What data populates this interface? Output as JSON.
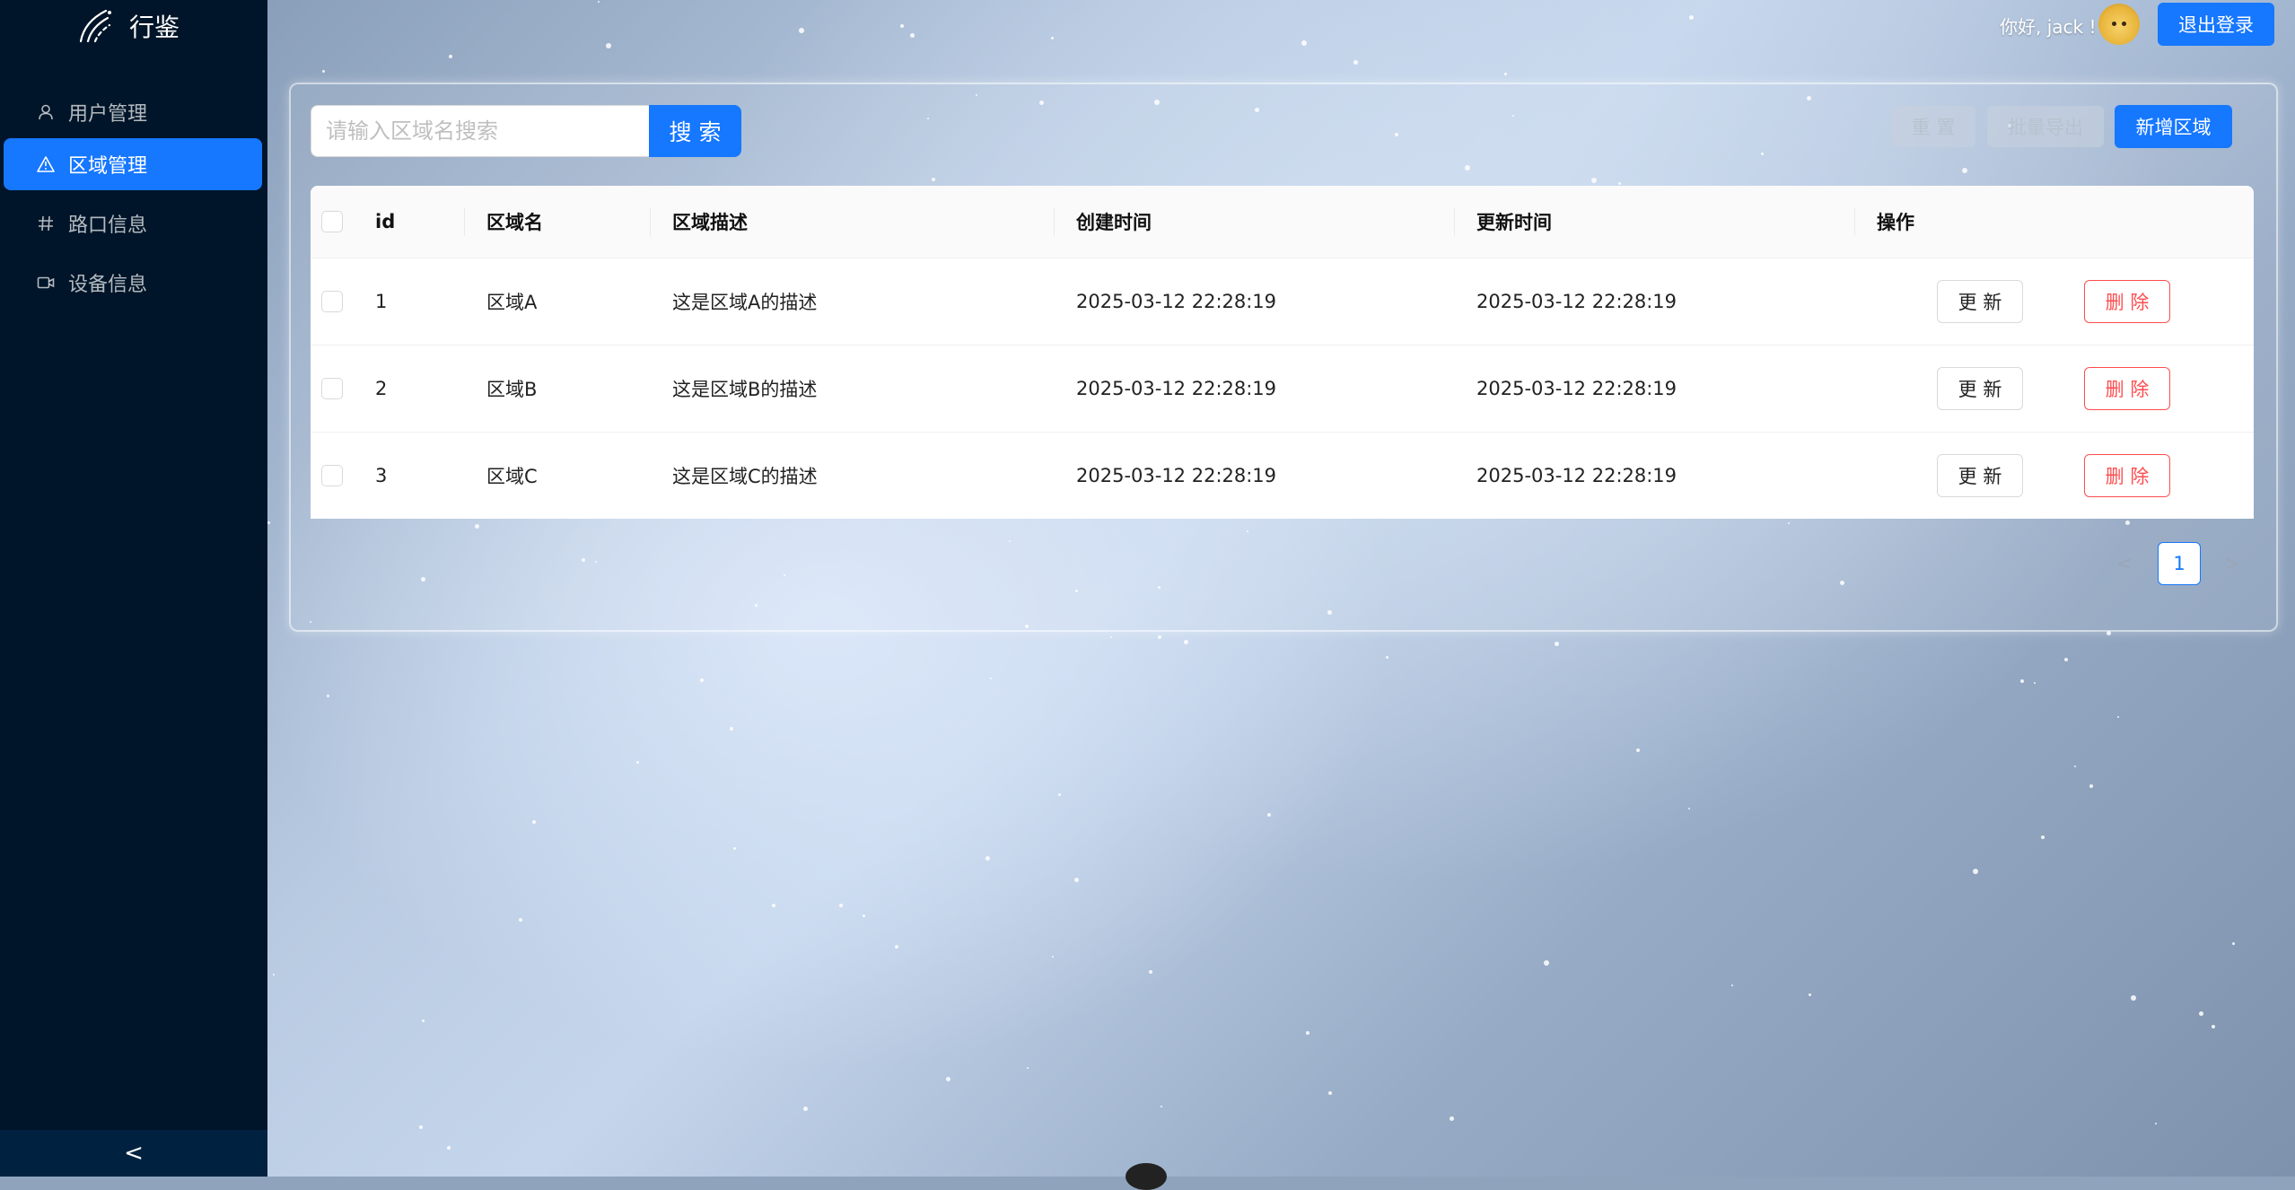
{
  "app": {
    "title": "行鉴"
  },
  "sidebar": {
    "items": [
      {
        "label": "用户管理",
        "icon": "user-icon",
        "active": false
      },
      {
        "label": "区域管理",
        "icon": "alert-triangle-icon",
        "active": true
      },
      {
        "label": "路口信息",
        "icon": "hash-icon",
        "active": false
      },
      {
        "label": "设备信息",
        "icon": "video-icon",
        "active": false
      }
    ],
    "collapse_label": "<"
  },
  "header": {
    "greeting": "你好, jack !",
    "logout_label": "退出登录"
  },
  "toolbar": {
    "search_placeholder": "请输入区域名搜索",
    "search_value": "",
    "search_label": "搜 索",
    "reset_label": "重 置",
    "export_label": "批量导出",
    "add_label": "新增区域"
  },
  "table": {
    "columns": [
      "id",
      "区域名",
      "区域描述",
      "创建时间",
      "更新时间",
      "操作"
    ],
    "rows": [
      {
        "id": "1",
        "name": "区域A",
        "desc": "这是区域A的描述",
        "created": "2025-03-12 22:28:19",
        "updated": "2025-03-12 22:28:19"
      },
      {
        "id": "2",
        "name": "区域B",
        "desc": "这是区域B的描述",
        "created": "2025-03-12 22:28:19",
        "updated": "2025-03-12 22:28:19"
      },
      {
        "id": "3",
        "name": "区域C",
        "desc": "这是区域C的描述",
        "created": "2025-03-12 22:28:19",
        "updated": "2025-03-12 22:28:19"
      }
    ],
    "update_label": "更 新",
    "delete_label": "删 除"
  },
  "pagination": {
    "current": "1",
    "prev": "<",
    "next": ">"
  },
  "colors": {
    "primary": "#1677ff",
    "sidebar": "#001529",
    "danger": "#ff4d4f"
  }
}
